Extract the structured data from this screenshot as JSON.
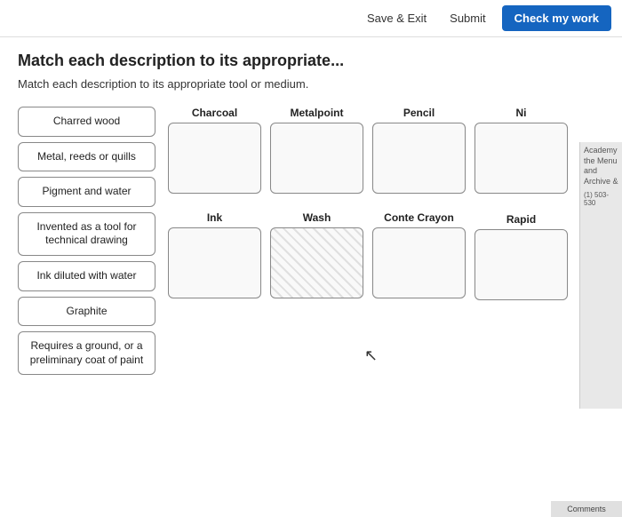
{
  "topBar": {
    "saveExitLabel": "Save & Exit",
    "submitLabel": "Submit",
    "checkMyWorkLabel": "Check my work"
  },
  "question": {
    "title": "Match each description to its appropriate...",
    "subtitle": "Match each description to its appropriate tool or medium."
  },
  "leftItems": [
    {
      "id": "charred-wood",
      "label": "Charred wood"
    },
    {
      "id": "metal-reeds",
      "label": "Metal, reeds or quills"
    },
    {
      "id": "pigment-water",
      "label": "Pigment and water"
    },
    {
      "id": "invented-tool",
      "label": "Invented as a tool for technical drawing"
    },
    {
      "id": "ink-diluted",
      "label": "Ink diluted with water"
    },
    {
      "id": "graphite",
      "label": "Graphite"
    },
    {
      "id": "requires-ground",
      "label": "Requires a ground, or a preliminary coat of paint"
    }
  ],
  "dropZoneRows": [
    {
      "zones": [
        {
          "id": "charcoal",
          "label": "Charcoal",
          "hatched": false
        },
        {
          "id": "metalpoint",
          "label": "Metalpoint",
          "hatched": false
        },
        {
          "id": "pencil",
          "label": "Pencil",
          "hatched": false
        },
        {
          "id": "ni",
          "label": "Ni",
          "hatched": false,
          "partial": true
        }
      ]
    },
    {
      "zones": [
        {
          "id": "ink",
          "label": "Ink",
          "hatched": false
        },
        {
          "id": "wash",
          "label": "Wash",
          "hatched": true
        },
        {
          "id": "conte-crayon",
          "label": "Conte Crayon",
          "hatched": false
        },
        {
          "id": "rapid",
          "label": "Rapid",
          "hatched": false,
          "partial": true
        }
      ]
    }
  ],
  "sidePanel": {
    "academyLabel": "Academy",
    "menuLabel": "the Menu",
    "archiveLabel": "and Archive &",
    "phone": "(1) 503-530"
  },
  "bottomBar": {
    "label": "Comments"
  }
}
